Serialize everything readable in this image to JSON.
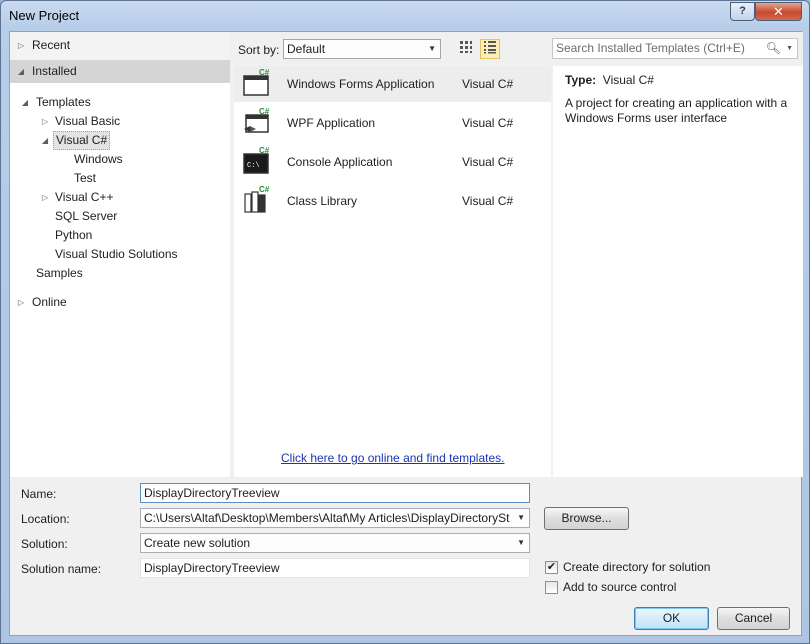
{
  "window": {
    "title": "New Project",
    "help": "?",
    "close": "✕"
  },
  "tree": {
    "recent": "Recent",
    "installed": "Installed",
    "templates": "Templates",
    "visual_basic": "Visual Basic",
    "visual_csharp": "Visual C#",
    "windows": "Windows",
    "test": "Test",
    "visual_cpp": "Visual C++",
    "sql_server": "SQL Server",
    "python": "Python",
    "vs_solutions": "Visual Studio Solutions",
    "samples": "Samples",
    "online": "Online"
  },
  "toolbar": {
    "sort_by_label": "Sort by:",
    "sort_value": "Default",
    "small_icons_icon": "small-icons-view",
    "list_icon": "list-view",
    "search_placeholder": "Search Installed Templates (Ctrl+E)"
  },
  "templates": [
    {
      "name": "Windows Forms Application",
      "lang": "Visual C#",
      "icon": "winforms-icon"
    },
    {
      "name": "WPF Application",
      "lang": "Visual C#",
      "icon": "wpf-icon"
    },
    {
      "name": "Console Application",
      "lang": "Visual C#",
      "icon": "console-icon"
    },
    {
      "name": "Class Library",
      "lang": "Visual C#",
      "icon": "class-library-icon"
    }
  ],
  "online_link": "Click here to go online and find templates.",
  "details": {
    "type_label": "Type:",
    "type_value": "Visual C#",
    "description": "A project for creating an application with a Windows Forms user interface"
  },
  "form": {
    "name_label": "Name:",
    "name_value": "DisplayDirectoryTreeview",
    "location_label": "Location:",
    "location_value": "C:\\Users\\Altaf\\Desktop\\Members\\Altaf\\My Articles\\DisplayDirectorySt",
    "browse": "Browse...",
    "solution_label": "Solution:",
    "solution_value": "Create new solution",
    "solution_name_label": "Solution name:",
    "solution_name_value": "DisplayDirectoryTreeview",
    "create_dir_label": "Create directory for solution",
    "create_dir_checked": true,
    "add_source_label": "Add to source control",
    "add_source_checked": false,
    "ok": "OK",
    "cancel": "Cancel"
  }
}
